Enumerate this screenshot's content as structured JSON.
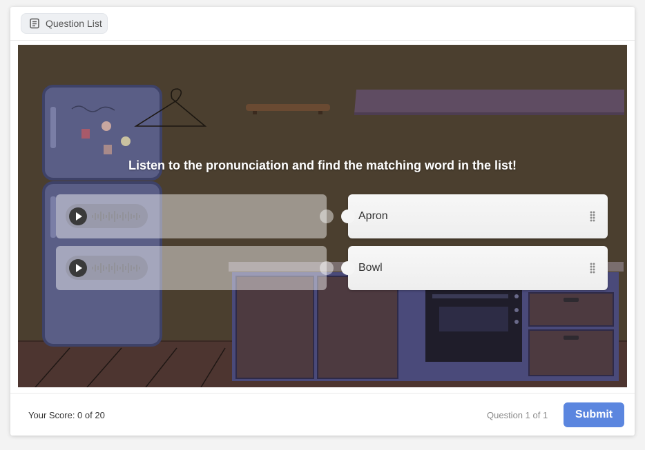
{
  "header": {
    "question_list_label": "Question List",
    "question_list_icon": "list-icon"
  },
  "quiz": {
    "prompt": "Listen to the pronunciation and find the matching word in the list!",
    "audio_items": [
      {
        "icon": "play-icon"
      },
      {
        "icon": "play-icon"
      }
    ],
    "word_items": [
      {
        "label": "Apron",
        "icon": "drag-handle-icon"
      },
      {
        "label": "Bowl",
        "icon": "drag-handle-icon"
      }
    ]
  },
  "footer": {
    "score_text": "Your Score: 0 of 20",
    "question_progress": "Question 1 of 1",
    "submit_label": "Submit"
  },
  "colors": {
    "accent": "#5b86df",
    "stage_background": "#4b3f2f",
    "card_background": "#ffffff"
  }
}
